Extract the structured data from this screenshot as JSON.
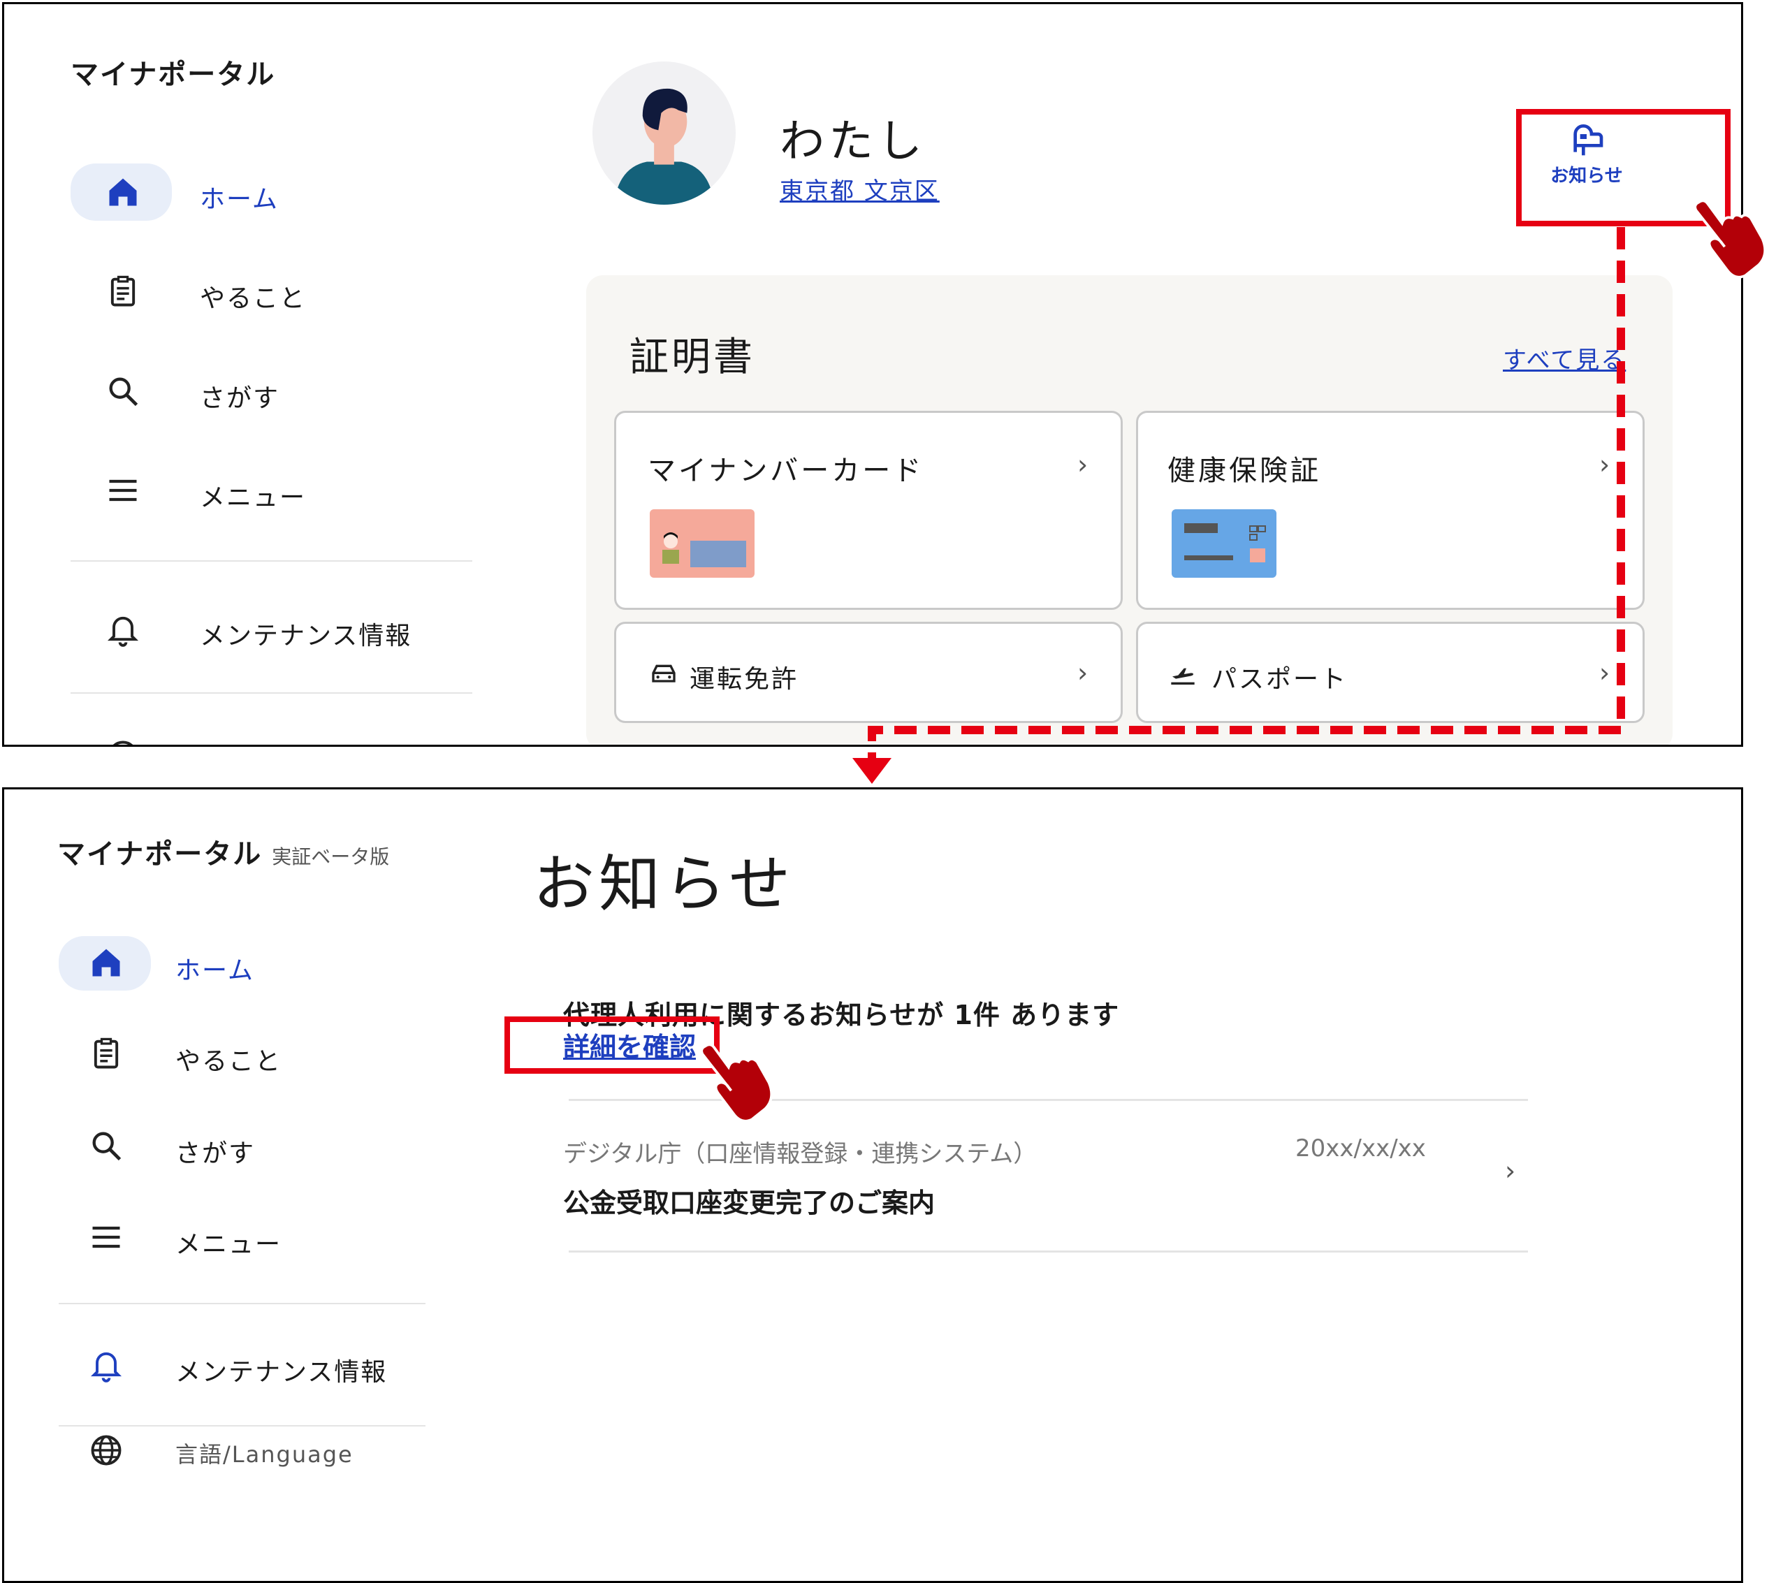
{
  "panel_top": {
    "logo": "マイナポータル",
    "nav": [
      {
        "label": "ホーム",
        "icon": "home-icon",
        "active": true
      },
      {
        "label": "やること",
        "icon": "clipboard-icon",
        "active": false
      },
      {
        "label": "さがす",
        "icon": "search-icon",
        "active": false
      },
      {
        "label": "メニュー",
        "icon": "menu-icon",
        "active": false
      }
    ],
    "nav_secondary": [
      {
        "label": "メンテナンス情報",
        "icon": "bell-icon"
      }
    ],
    "profile": {
      "name": "わたし",
      "location": "東京都 文京区"
    },
    "notice_button": {
      "label": "お知らせ",
      "icon": "mailbox-icon"
    },
    "certificates": {
      "title": "証明書",
      "see_all": "すべて見る",
      "cards": [
        {
          "label": "マイナンバーカード",
          "icon": "mynumber-card-icon"
        },
        {
          "label": "健康保険証",
          "icon": "insurance-card-icon"
        },
        {
          "label": "運転免許",
          "icon": "car-icon"
        },
        {
          "label": "パスポート",
          "icon": "airplane-icon"
        }
      ]
    }
  },
  "panel_bottom": {
    "logo": "マイナポータル",
    "beta": "実証ベータ版",
    "nav": [
      {
        "label": "ホーム",
        "icon": "home-icon",
        "active": true
      },
      {
        "label": "やること",
        "icon": "clipboard-icon",
        "active": false
      },
      {
        "label": "さがす",
        "icon": "search-icon",
        "active": false
      },
      {
        "label": "メニュー",
        "icon": "menu-icon",
        "active": false
      }
    ],
    "nav_secondary": [
      {
        "label": "メンテナンス情報",
        "icon": "bell-icon"
      },
      {
        "label": "言語/Language",
        "icon": "globe-icon"
      }
    ],
    "page_title": "お知らせ",
    "proxy_notice": "代理人利用に関するお知らせが 1件 あります",
    "detail_link": "詳細を確認",
    "notifications": [
      {
        "sender": "デジタル庁（口座情報登録・連携システム）",
        "date": "20xx/xx/xx",
        "subject": "公金受取口座変更完了のご案内"
      }
    ]
  },
  "colors": {
    "accent": "#1e3fbf",
    "highlight": "#e60012",
    "nav_active_bg": "#e8eef9",
    "cert_bg": "#f7f6f3"
  }
}
